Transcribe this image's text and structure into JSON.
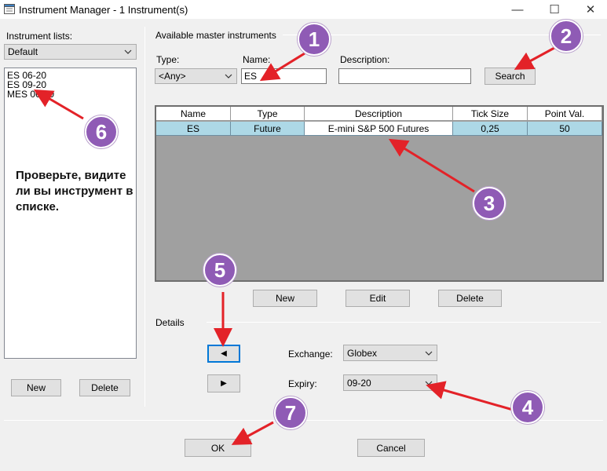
{
  "window": {
    "title": "Instrument Manager - 1 Instrument(s)",
    "controls": {
      "minimize": "—",
      "maximize": "☐",
      "close": "✕"
    }
  },
  "left_panel": {
    "lists_label": "Instrument lists:",
    "selected_list": "Default",
    "items": [
      "ES 06-20",
      "ES 09-20",
      "MES 06-20"
    ],
    "new_button": "New",
    "delete_button": "Delete"
  },
  "master": {
    "group_label": "Available master instruments",
    "type_label": "Type:",
    "type_value": "<Any>",
    "name_label": "Name:",
    "name_value": "ES",
    "description_label": "Description:",
    "description_value": "",
    "search_button": "Search",
    "columns": [
      "Name",
      "Type",
      "Description",
      "Tick Size",
      "Point Val."
    ],
    "rows": [
      [
        "ES",
        "Future",
        "E-mini S&P 500 Futures",
        "0,25",
        "50"
      ]
    ],
    "new_button": "New",
    "edit_button": "Edit",
    "delete_button": "Delete"
  },
  "details": {
    "group_label": "Details",
    "prev_button": "◀",
    "next_button": "▶",
    "exchange_label": "Exchange:",
    "exchange_value": "Globex",
    "expiry_label": "Expiry:",
    "expiry_value": "09-20"
  },
  "footer": {
    "ok_button": "OK",
    "cancel_button": "Cancel"
  },
  "annotations": {
    "note": "Проверьте, видите ли вы инструмент в списке.",
    "badges": [
      "1",
      "2",
      "3",
      "4",
      "5",
      "6",
      "7"
    ],
    "badge_color": "#8f5bb5",
    "arrow_color": "#e32228"
  }
}
